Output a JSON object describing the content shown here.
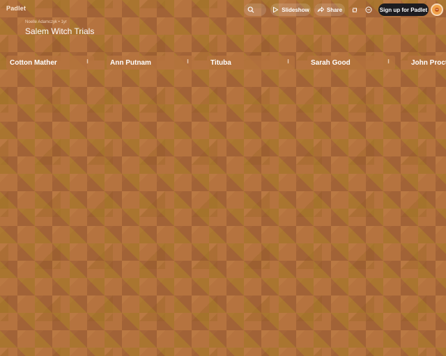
{
  "app": {
    "logo": "Padlet"
  },
  "toolbar": {
    "slideshow_label": "Slideshow",
    "share_label": "Share",
    "signup_label": "Sign up for Padlet"
  },
  "board": {
    "author": "Noelle Adamczyk • 1yr",
    "title": "Salem Witch Trials"
  },
  "columns": [
    {
      "title": "Cotton Mather"
    },
    {
      "title": "Ann Putnam"
    },
    {
      "title": "Tituba"
    },
    {
      "title": "Sarah Good"
    },
    {
      "title": "John Proctor"
    }
  ],
  "colors": {
    "background": "#b5733f",
    "signup_button": "#1d1c20",
    "avatar": "#f0a24a"
  },
  "icons": [
    "search-icon",
    "play-icon",
    "share-icon",
    "remake-icon",
    "more-icon"
  ]
}
